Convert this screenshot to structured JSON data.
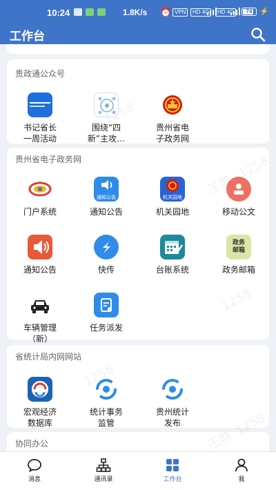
{
  "status_bar": {
    "time": "10:24",
    "net_speed": "1.8K/s",
    "vpn": "VPN",
    "signal_1": "HD 4G",
    "signal_2": "HD 4G",
    "battery": "74"
  },
  "app_bar": {
    "title": "工作台"
  },
  "sections": [
    {
      "title": "贵政通公众号",
      "items": [
        {
          "label": "书记省长\n一周活动",
          "icon": "news-banner-icon"
        },
        {
          "label": "围绕“四\n新”主攻…",
          "icon": "map-diagram-icon"
        },
        {
          "label": "贵州省电\n子政务网",
          "icon": "national-emblem-icon"
        }
      ]
    },
    {
      "title": "贵州省电子政务网",
      "items": [
        {
          "label": "门户系统",
          "icon": "portal-logo-icon"
        },
        {
          "label": "通知公告",
          "icon": "notice-speaker-icon"
        },
        {
          "label": "机关园地",
          "icon": "emblem-garden-icon"
        },
        {
          "label": "移动公文",
          "icon": "document-person-icon"
        },
        {
          "label": "通知公告",
          "icon": "megaphone-icon"
        },
        {
          "label": "快传",
          "icon": "quick-send-icon"
        },
        {
          "label": "台账系统",
          "icon": "calendar-ledger-icon"
        },
        {
          "label": "政务邮箱",
          "icon": "gov-mailbox-icon"
        },
        {
          "label": "车辆管理\n（新）",
          "icon": "car-icon"
        },
        {
          "label": "任务派发",
          "icon": "task-dispatch-icon"
        }
      ]
    },
    {
      "title": "省统计局内网网站",
      "items": [
        {
          "label": "宏观经济\n数据库",
          "icon": "stats-db-icon"
        },
        {
          "label": "统计事务\n监管",
          "icon": "stats-logo-icon"
        },
        {
          "label": "贵州统计\n发布",
          "icon": "stats-logo-icon"
        }
      ]
    },
    {
      "title": "协同办公",
      "items": []
    }
  ],
  "icon_texts": {
    "notice_speaker": "通知公告",
    "emblem_garden": "机关园地",
    "gov_mailbox": "政务\n邮箱"
  },
  "watermark": {
    "name": "王群",
    "number": "1258"
  },
  "tab_bar": [
    {
      "label": "消息",
      "icon": "chat-icon",
      "active": false
    },
    {
      "label": "通讯录",
      "icon": "org-chart-icon",
      "active": false
    },
    {
      "label": "工作台",
      "icon": "grid-icon",
      "active": true
    },
    {
      "label": "我",
      "icon": "person-icon",
      "active": false
    }
  ],
  "colors": {
    "primary": "#3f75c9",
    "background": "#eef1f5"
  }
}
